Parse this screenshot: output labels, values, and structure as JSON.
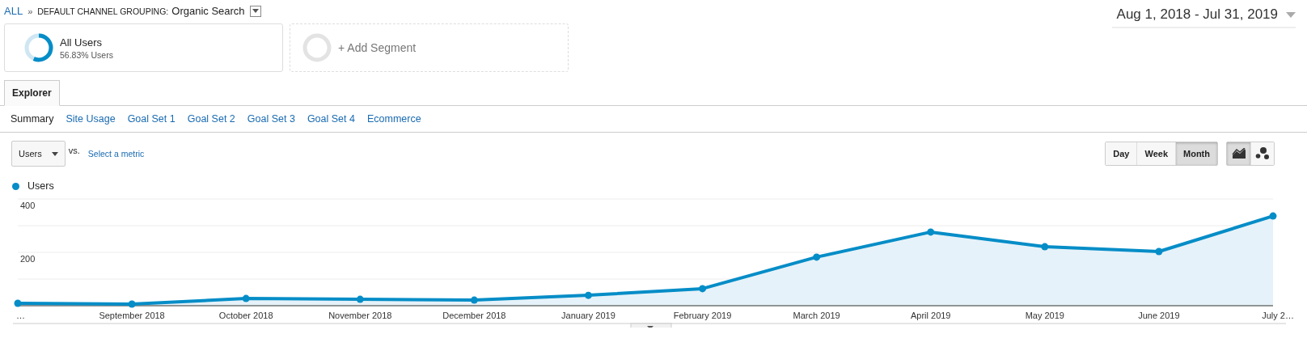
{
  "breadcrumb": {
    "root": "ALL",
    "separator": "»",
    "dimension": "DEFAULT CHANNEL GROUPING:",
    "value": "Organic Search"
  },
  "date_range": "Aug 1, 2018 - Jul 31, 2019",
  "segments": [
    {
      "kind": "segment",
      "title": "All Users",
      "subtitle": "56.83% Users",
      "level": 0.5683
    },
    {
      "kind": "add",
      "title": "+ Add Segment"
    }
  ],
  "tabs": [
    {
      "label": "Explorer",
      "selected": true
    }
  ],
  "subtabs": [
    {
      "label": "Summary",
      "selected": true
    },
    {
      "label": "Site Usage",
      "selected": false
    },
    {
      "label": "Goal Set 1",
      "selected": false
    },
    {
      "label": "Goal Set 2",
      "selected": false
    },
    {
      "label": "Goal Set 3",
      "selected": false
    },
    {
      "label": "Goal Set 4",
      "selected": false
    },
    {
      "label": "Ecommerce",
      "selected": false
    }
  ],
  "metric": {
    "value": "Users",
    "vs": "vs.",
    "link": "Select a metric"
  },
  "periods": [
    {
      "label": "Day",
      "selected": false
    },
    {
      "label": "Week",
      "selected": false
    },
    {
      "label": "Month",
      "selected": true
    }
  ],
  "chart_types": [
    {
      "kind": "line",
      "selected": true
    },
    {
      "kind": "motion",
      "selected": false
    }
  ],
  "chart": {
    "chart_data": {
      "type": "area",
      "categories": [
        "…",
        "September 2018",
        "October 2018",
        "November 2018",
        "December 2018",
        "January 2019",
        "February 2019",
        "March 2019",
        "April 2019",
        "May 2019",
        "June 2019",
        "July 2…"
      ],
      "series": [
        {
          "name": "Users",
          "color": "#058dc7",
          "values": [
            9,
            6,
            27,
            24,
            21,
            39,
            64,
            182,
            276,
            221,
            203,
            336
          ]
        }
      ],
      "ylim": [
        0,
        400
      ],
      "yticks": [
        {
          "value": 200,
          "label": "200"
        },
        {
          "value": 400,
          "label": "400"
        }
      ]
    }
  }
}
